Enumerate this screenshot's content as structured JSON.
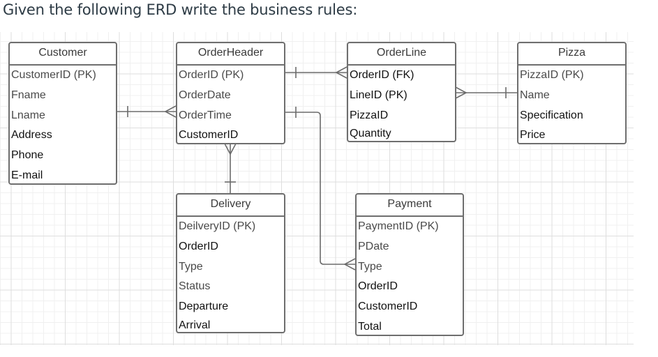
{
  "prompt": {
    "text": "Given the following ERD write the business rules:"
  },
  "colors": {
    "text": "#2d3b45",
    "entity_border": "#6e6e6e",
    "connector": "#6b6b6b",
    "grid_major": "#dedede",
    "grid_minor": "#f0f0f0"
  },
  "entities": {
    "customer": {
      "name": "Customer",
      "attributes": [
        "CustomerID (PK)",
        "Fname",
        "Lname",
        "Address",
        "Phone",
        "E-mail"
      ]
    },
    "orderheader": {
      "name": "OrderHeader",
      "attributes": [
        "OrderID (PK)",
        "OrderDate",
        "OrderTime",
        "CustomerID"
      ]
    },
    "orderline": {
      "name": "OrderLine",
      "attributes": [
        "OrderID (FK)",
        "LineID (PK)",
        "PizzaID",
        "Quantity"
      ]
    },
    "pizza": {
      "name": "Pizza",
      "attributes": [
        "PizzaID (PK)",
        "Name",
        "Specification",
        "Price"
      ]
    },
    "delivery": {
      "name": "Delivery",
      "attributes": [
        "DeilveryID (PK)",
        "OrderID",
        "Type",
        "Status",
        "Departure",
        "Arrival"
      ]
    },
    "payment": {
      "name": "Payment",
      "attributes": [
        "PaymentID (PK)",
        "PDate",
        "Type",
        "OrderID",
        "CustomerID",
        "Total"
      ]
    }
  },
  "relationships": [
    {
      "from": "Customer",
      "from_cardinality": "one",
      "to": "OrderHeader",
      "to_cardinality": "many"
    },
    {
      "from": "OrderHeader",
      "from_cardinality": "one",
      "to": "OrderLine",
      "to_cardinality": "many"
    },
    {
      "from": "Pizza",
      "from_cardinality": "one",
      "to": "OrderLine",
      "to_cardinality": "many"
    },
    {
      "from": "Delivery",
      "from_cardinality": "one",
      "to": "OrderHeader",
      "to_cardinality": "many"
    },
    {
      "from": "OrderHeader",
      "from_cardinality": "one",
      "to": "Payment",
      "to_cardinality": "many"
    }
  ]
}
